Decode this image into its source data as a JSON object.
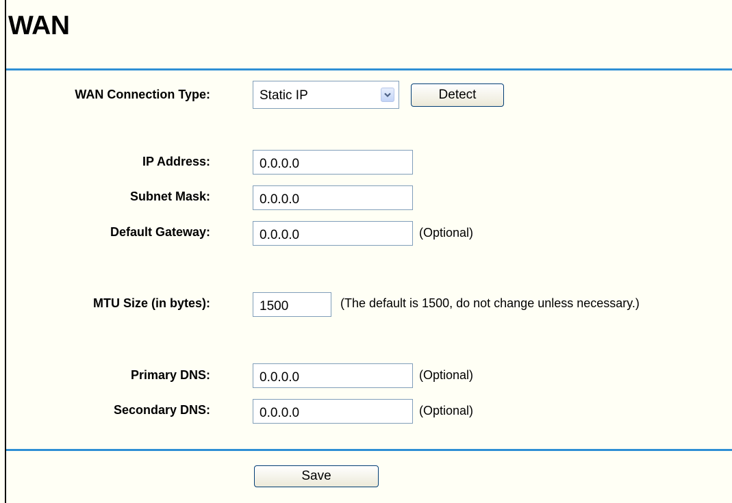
{
  "page": {
    "title": "WAN"
  },
  "connection": {
    "label": "WAN Connection Type:",
    "selected": "Static IP",
    "detect_label": "Detect"
  },
  "ip": {
    "label": "IP Address:",
    "value": "0.0.0.0"
  },
  "subnet": {
    "label": "Subnet Mask:",
    "value": "0.0.0.0"
  },
  "gateway": {
    "label": "Default Gateway:",
    "value": "0.0.0.0",
    "note": "(Optional)"
  },
  "mtu": {
    "label": "MTU Size (in bytes):",
    "value": "1500",
    "note": "(The default is 1500, do not change unless necessary.)"
  },
  "primary_dns": {
    "label": "Primary DNS:",
    "value": "0.0.0.0",
    "note": "(Optional)"
  },
  "secondary_dns": {
    "label": "Secondary DNS:",
    "value": "0.0.0.0",
    "note": "(Optional)"
  },
  "actions": {
    "save_label": "Save"
  },
  "colors": {
    "background": "#fffff5",
    "rule": "#2e8fd4",
    "field_border": "#7f9db9"
  },
  "icons": {
    "select_arrow": "chevron-down-icon"
  }
}
